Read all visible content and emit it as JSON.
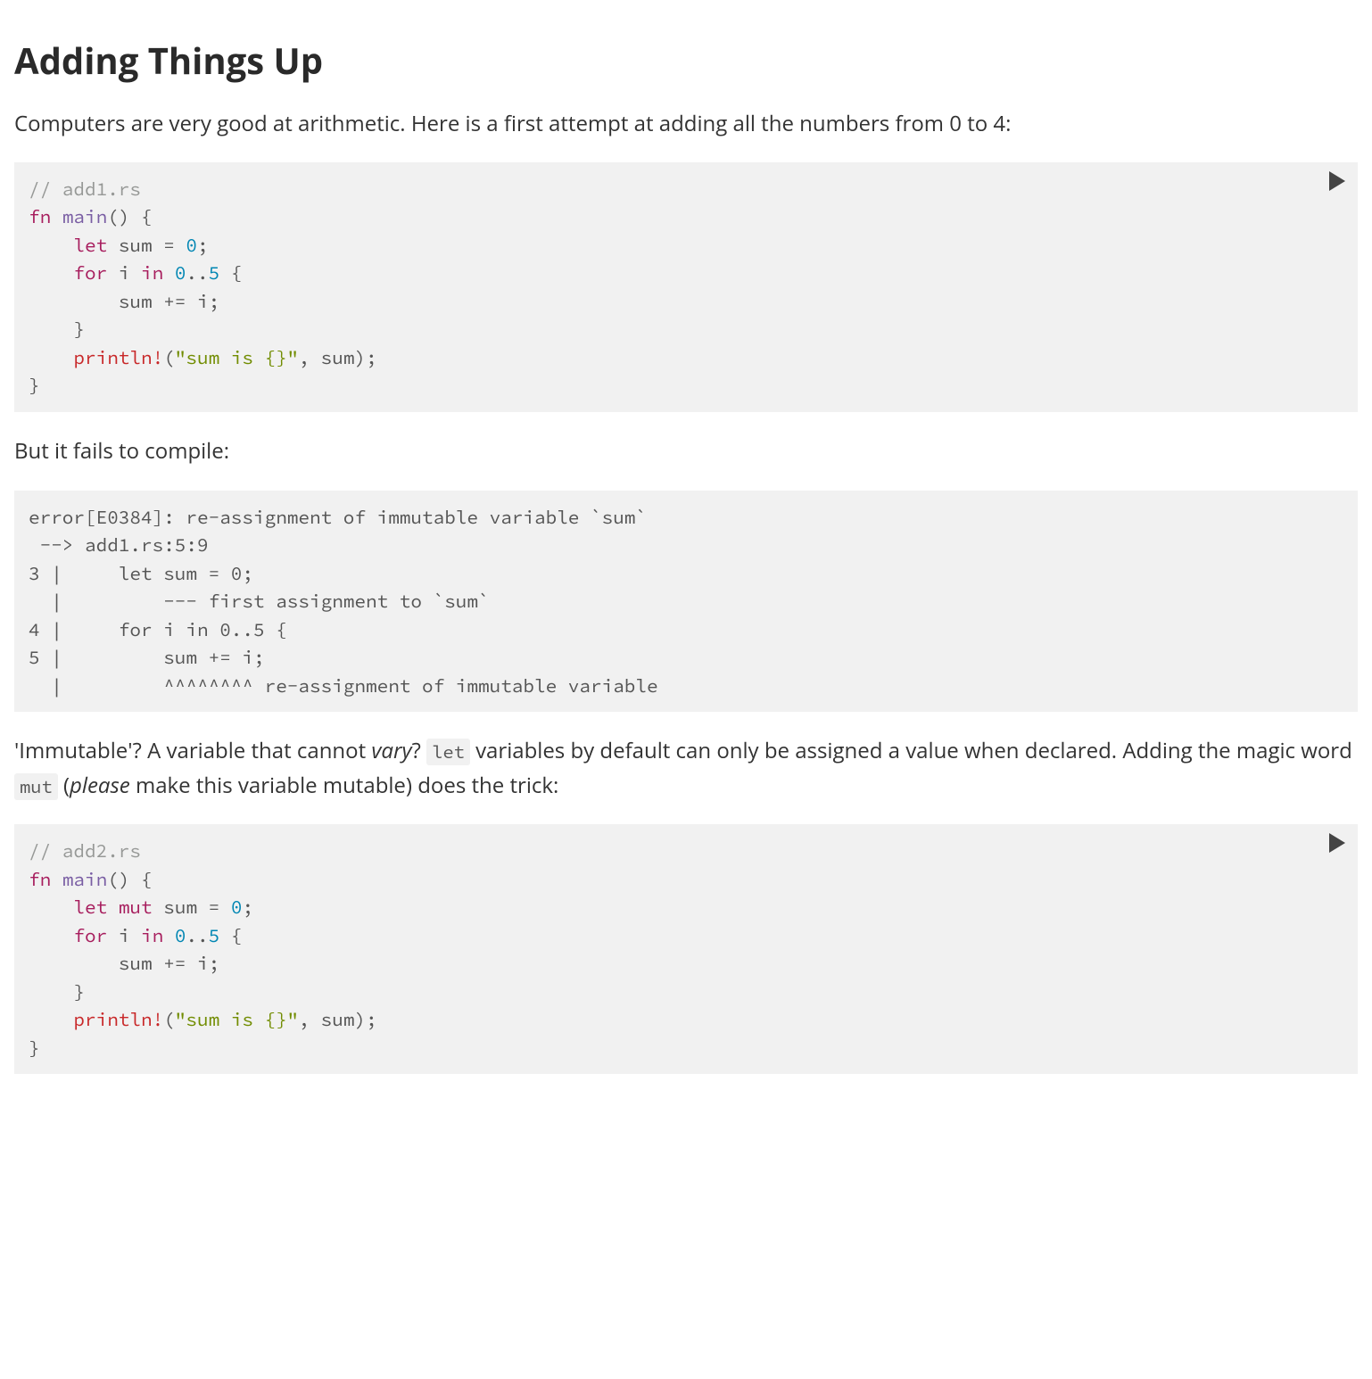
{
  "heading": "Adding Things Up",
  "para1": "Computers are very good at arithmetic. Here is a first attempt at adding all the numbers from 0 to 4:",
  "code1": {
    "comment": "// add1.rs",
    "kw_fn": "fn",
    "fn_name": "main",
    "after_main": "() {",
    "indent1": "    ",
    "kw_let": "let",
    "let_rest": " sum = ",
    "num0": "0",
    "semi": ";",
    "kw_for": "for",
    "for_mid": " i ",
    "kw_in": "in",
    "range_sp": " ",
    "range_lo": "0",
    "range_dots": "..",
    "range_hi": "5",
    "for_brace": " {",
    "indent2": "        ",
    "sumline": "sum += i;",
    "close_brace1": "    }",
    "macro": "println!",
    "print_open": "(",
    "str": "\"sum is {}\"",
    "print_rest": ", sum);",
    "close_brace2": "}"
  },
  "para2": "But it fails to compile:",
  "error_block": "error[E0384]: re-assignment of immutable variable `sum`\n --> add1.rs:5:9\n3 |     let sum = 0;\n  |         --- first assignment to `sum`\n4 |     for i in 0..5 {\n5 |         sum += i;\n  |         ^^^^^^^^ re-assignment of immutable variable",
  "para3": {
    "t1": "'Immutable'? A variable that cannot ",
    "em1": "vary",
    "t2": "? ",
    "code_let": "let",
    "t3": " variables by default can only be assigned a value when declared. Adding the magic word ",
    "code_mut": "mut",
    "t4": " (",
    "em2": "please",
    "t5": " make this variable mutable) does the trick:"
  },
  "code2": {
    "comment": "// add2.rs",
    "kw_fn": "fn",
    "fn_name": "main",
    "after_main": "() {",
    "indent1": "    ",
    "kw_let": "let",
    "sp": " ",
    "kw_mut": "mut",
    "let_rest": " sum = ",
    "num0": "0",
    "semi": ";",
    "kw_for": "for",
    "for_mid": " i ",
    "kw_in": "in",
    "range_sp": " ",
    "range_lo": "0",
    "range_dots": "..",
    "range_hi": "5",
    "for_brace": " {",
    "indent2": "        ",
    "sumline": "sum += i;",
    "close_brace1": "    }",
    "macro": "println!",
    "print_open": "(",
    "str": "\"sum is {}\"",
    "print_rest": ", sum);",
    "close_brace2": "}"
  }
}
